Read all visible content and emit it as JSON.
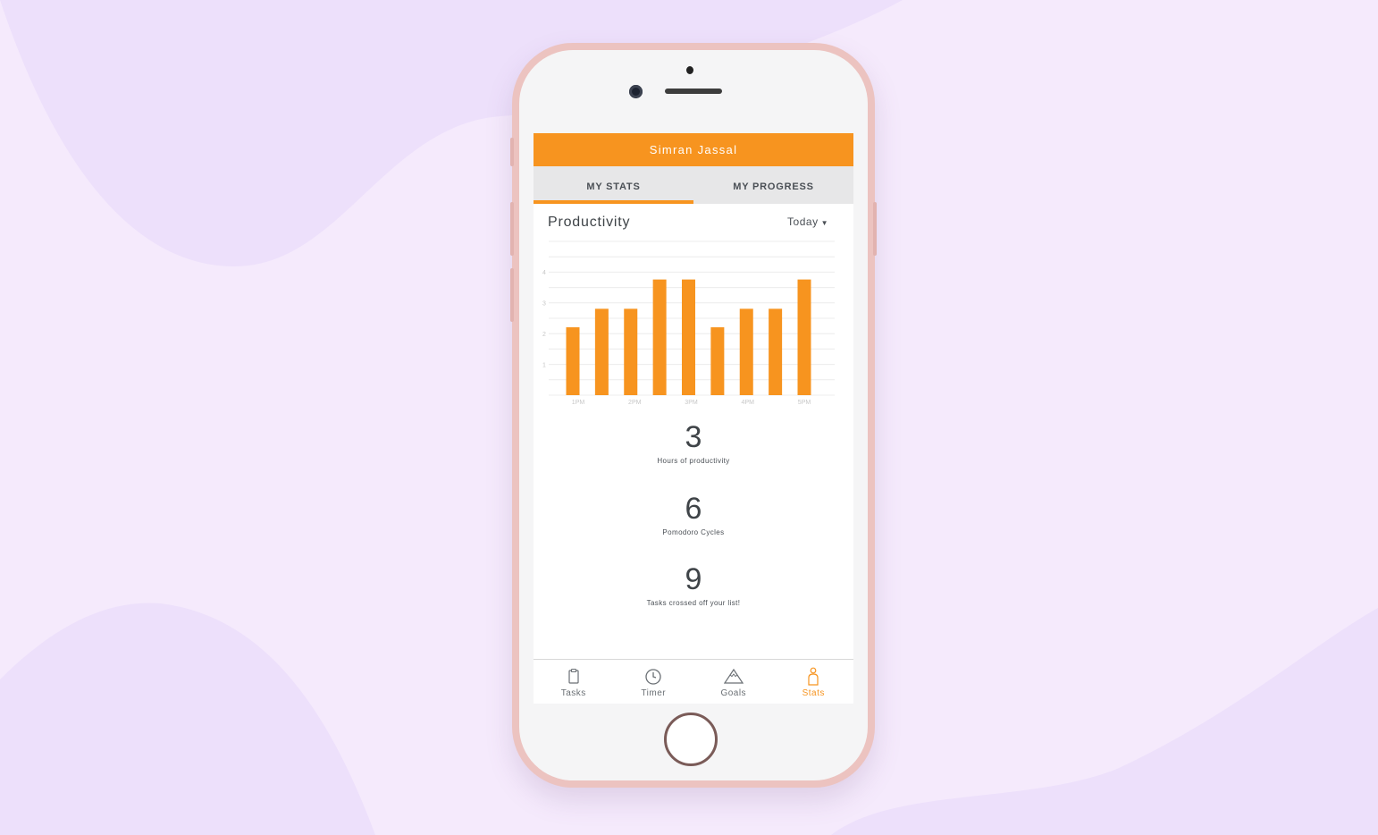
{
  "app": {
    "user_name": "Simran Jassal",
    "accent_color": "#f7941f"
  },
  "tabs": [
    {
      "label": "MY STATS",
      "active": true
    },
    {
      "label": "MY PROGRESS",
      "active": false
    }
  ],
  "section": {
    "title": "Productivity",
    "range_label": "Today",
    "range_icon": "caret-down-icon"
  },
  "chart_data": {
    "type": "bar",
    "title": "",
    "xlabel": "",
    "ylabel": "",
    "ylim": [
      0,
      4
    ],
    "yticks": [
      "1",
      "2",
      "3",
      "4"
    ],
    "xtick_labels": [
      "1PM",
      "2PM",
      "3PM",
      "4PM",
      "5PM"
    ],
    "values": [
      2.2,
      2.8,
      2.8,
      3.75,
      3.75,
      2.2,
      2.8,
      2.8,
      3.75
    ],
    "bar_color": "#f7941f",
    "grid": true
  },
  "stats": [
    {
      "value": "3",
      "label": "Hours of productivity"
    },
    {
      "value": "6",
      "label": "Pomodoro Cycles"
    },
    {
      "value": "9",
      "label": "Tasks crossed off your list!"
    }
  ],
  "bottom_nav": [
    {
      "label": "Tasks",
      "icon": "clipboard-icon",
      "active": false
    },
    {
      "label": "Timer",
      "icon": "clock-icon",
      "active": false
    },
    {
      "label": "Goals",
      "icon": "mountain-icon",
      "active": false
    },
    {
      "label": "Stats",
      "icon": "person-icon",
      "active": true
    }
  ]
}
